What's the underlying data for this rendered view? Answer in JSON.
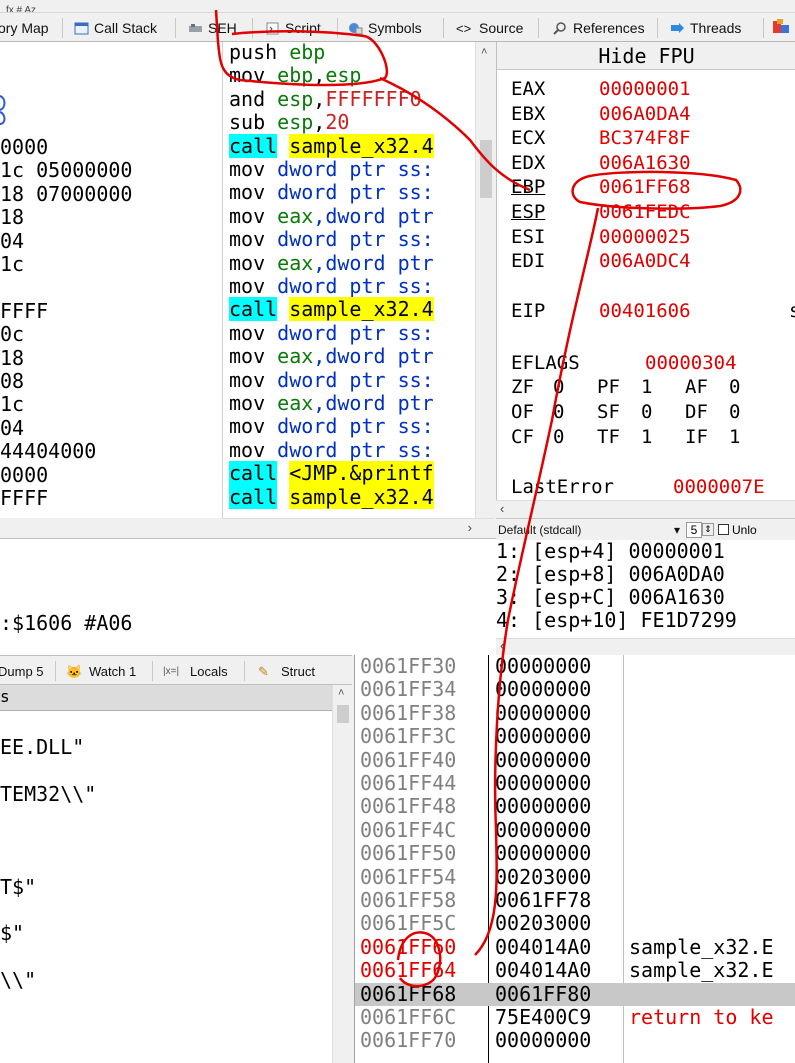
{
  "topbar": {
    "glyphs": "fx  #  Az"
  },
  "tabs": [
    {
      "label": "ory Map"
    },
    {
      "label": "Call Stack"
    },
    {
      "label": "SEH"
    },
    {
      "label": "Script"
    },
    {
      "label": "Symbols"
    },
    {
      "label": "Source"
    },
    {
      "label": "References"
    },
    {
      "label": "Threads"
    }
  ],
  "left_fragments": [
    "0000",
    "1c 05000000",
    "18 07000000",
    "18",
    "04",
    "1c",
    "",
    "FFFF",
    "0c",
    "18",
    "08",
    "1c",
    "04",
    "44404000",
    "0000",
    "FFFF"
  ],
  "disasm": [
    {
      "op": "push",
      "args": [
        {
          "t": "ebp",
          "c": "rg"
        }
      ],
      "hl": "none"
    },
    {
      "op": "mov",
      "args": [
        {
          "t": "ebp",
          "c": "rg"
        },
        {
          "t": ",",
          "c": "kw"
        },
        {
          "t": "esp",
          "c": "rg"
        }
      ],
      "hl": "none"
    },
    {
      "op": "and",
      "args": [
        {
          "t": "esp",
          "c": "rg"
        },
        {
          "t": ",",
          "c": "kw"
        },
        {
          "t": "FFFFFFF0",
          "c": "num"
        }
      ],
      "hl": "none"
    },
    {
      "op": "sub",
      "args": [
        {
          "t": "esp",
          "c": "rg"
        },
        {
          "t": ",",
          "c": "kw"
        },
        {
          "t": "20",
          "c": "num"
        }
      ],
      "hl": "none"
    },
    {
      "op": "call",
      "args": [
        {
          "t": "sample_x32.4",
          "c": "kw"
        }
      ],
      "hl": "call"
    },
    {
      "op": "mov",
      "args": [
        {
          "t": "dword ptr ss:",
          "c": "dp"
        }
      ],
      "hl": "none"
    },
    {
      "op": "mov",
      "args": [
        {
          "t": "dword ptr ss:",
          "c": "dp"
        }
      ],
      "hl": "none"
    },
    {
      "op": "mov",
      "args": [
        {
          "t": "eax",
          "c": "rg"
        },
        {
          "t": ",dword ptr",
          "c": "dp"
        }
      ],
      "hl": "none"
    },
    {
      "op": "mov",
      "args": [
        {
          "t": "dword ptr ss:",
          "c": "dp"
        }
      ],
      "hl": "none"
    },
    {
      "op": "mov",
      "args": [
        {
          "t": "eax",
          "c": "rg"
        },
        {
          "t": ",dword ptr",
          "c": "dp"
        }
      ],
      "hl": "none"
    },
    {
      "op": "mov",
      "args": [
        {
          "t": "dword ptr ss:",
          "c": "dp"
        }
      ],
      "hl": "none"
    },
    {
      "op": "call",
      "args": [
        {
          "t": "sample_x32.4",
          "c": "kw"
        }
      ],
      "hl": "call"
    },
    {
      "op": "mov",
      "args": [
        {
          "t": "dword ptr ss:",
          "c": "dp"
        }
      ],
      "hl": "none"
    },
    {
      "op": "mov",
      "args": [
        {
          "t": "eax",
          "c": "rg"
        },
        {
          "t": ",dword ptr",
          "c": "dp"
        }
      ],
      "hl": "none"
    },
    {
      "op": "mov",
      "args": [
        {
          "t": "dword ptr ss:",
          "c": "dp"
        }
      ],
      "hl": "none"
    },
    {
      "op": "mov",
      "args": [
        {
          "t": "eax",
          "c": "rg"
        },
        {
          "t": ",dword ptr",
          "c": "dp"
        }
      ],
      "hl": "none"
    },
    {
      "op": "mov",
      "args": [
        {
          "t": "dword ptr ss:",
          "c": "dp"
        }
      ],
      "hl": "none"
    },
    {
      "op": "mov",
      "args": [
        {
          "t": "dword ptr ss:",
          "c": "dp"
        }
      ],
      "hl": "none"
    },
    {
      "op": "call",
      "args": [
        {
          "t": "<JMP.&printf",
          "c": "kw"
        }
      ],
      "hl": "call"
    },
    {
      "op": "call",
      "args": [
        {
          "t": "sample_x32.4",
          "c": "kw"
        }
      ],
      "hl": "call"
    }
  ],
  "regs": {
    "title": "Hide FPU",
    "list": [
      {
        "name": "EAX",
        "value": "00000001"
      },
      {
        "name": "EBX",
        "value": "006A0DA4"
      },
      {
        "name": "ECX",
        "value": "BC374F8F"
      },
      {
        "name": "EDX",
        "value": "006A1630"
      },
      {
        "name": "EBP",
        "value": "0061FF68"
      },
      {
        "name": "ESP",
        "value": "0061FEDC"
      },
      {
        "name": "ESI",
        "value": "00000025"
      },
      {
        "name": "EDI",
        "value": "006A0DC4"
      }
    ],
    "eip": {
      "name": "EIP",
      "value": "00401606",
      "tail": "s"
    },
    "eflags": {
      "name": "EFLAGS",
      "value": "00000304"
    },
    "flags": [
      [
        "ZF",
        "0",
        "PF",
        "1",
        "AF",
        "0"
      ],
      [
        "OF",
        "0",
        "SF",
        "0",
        "DF",
        "0"
      ],
      [
        "CF",
        "0",
        "TF",
        "1",
        "IF",
        "1"
      ]
    ],
    "lasterror": {
      "name": "LastError",
      "value": "0000007E"
    }
  },
  "callconv": {
    "select": "Default (stdcall)",
    "count": "5",
    "unlock": "Unlo"
  },
  "args": [
    "1: [esp+4] 00000001",
    "2: [esp+8] 006A0DA0",
    "3: [esp+C] 006A1630",
    "4: [esp+10] FE1D7299"
  ],
  "info_line": ":$1606 #A06",
  "bottom_tabs": [
    {
      "label": "Dump 5"
    },
    {
      "label": "Watch 1"
    },
    {
      "label": "Locals"
    },
    {
      "label": "Struct"
    }
  ],
  "locals": {
    "header": "s",
    "lines": [
      "EE.DLL\"",
      "TEM32\\\\\"",
      "",
      "T$\"",
      "$\"",
      "\\\\\""
    ]
  },
  "stack": [
    {
      "addr": "0061FF30",
      "val": "00000000",
      "cmt": ""
    },
    {
      "addr": "0061FF34",
      "val": "00000000",
      "cmt": ""
    },
    {
      "addr": "0061FF38",
      "val": "00000000",
      "cmt": ""
    },
    {
      "addr": "0061FF3C",
      "val": "00000000",
      "cmt": ""
    },
    {
      "addr": "0061FF40",
      "val": "00000000",
      "cmt": ""
    },
    {
      "addr": "0061FF44",
      "val": "00000000",
      "cmt": ""
    },
    {
      "addr": "0061FF48",
      "val": "00000000",
      "cmt": ""
    },
    {
      "addr": "0061FF4C",
      "val": "00000000",
      "cmt": ""
    },
    {
      "addr": "0061FF50",
      "val": "00000000",
      "cmt": ""
    },
    {
      "addr": "0061FF54",
      "val": "00203000",
      "cmt": ""
    },
    {
      "addr": "0061FF58",
      "val": "0061FF78",
      "cmt": ""
    },
    {
      "addr": "0061FF5C",
      "val": "00203000",
      "cmt": ""
    },
    {
      "addr": "0061FF60",
      "val": "004014A0",
      "cmt": "sample_x32.E"
    },
    {
      "addr": "0061FF64",
      "val": "004014A0",
      "cmt": "sample_x32.E"
    },
    {
      "addr": "0061FF68",
      "val": "0061FF80",
      "cmt": ""
    },
    {
      "addr": "0061FF6C",
      "val": "75E400C9",
      "cmt": "return to ke"
    },
    {
      "addr": "0061FF70",
      "val": "00000000",
      "cmt": ""
    }
  ],
  "colors": {
    "red": "#e00000",
    "cyan": "#00ffff",
    "yellow": "#ffff00",
    "selection": "#c8c8c8"
  }
}
